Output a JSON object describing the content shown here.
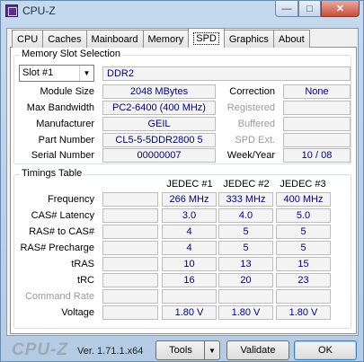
{
  "window": {
    "title": "CPU-Z",
    "minimize_icon": "minimize-icon",
    "maximize_icon": "maximize-icon",
    "close_icon": "close-icon"
  },
  "tabs": [
    {
      "label": "CPU"
    },
    {
      "label": "Caches"
    },
    {
      "label": "Mainboard"
    },
    {
      "label": "Memory"
    },
    {
      "label": "SPD",
      "active": true
    },
    {
      "label": "Graphics"
    },
    {
      "label": "About"
    }
  ],
  "slot": {
    "group_title": "Memory Slot Selection",
    "selected": "Slot #1",
    "type": "DDR2",
    "module_size_label": "Module Size",
    "module_size": "2048 MBytes",
    "max_bandwidth_label": "Max Bandwidth",
    "max_bandwidth": "PC2-6400 (400 MHz)",
    "manufacturer_label": "Manufacturer",
    "manufacturer": "GEIL",
    "part_number_label": "Part Number",
    "part_number": "CL5-5-5DDR2800  5",
    "serial_number_label": "Serial Number",
    "serial_number": "00000007",
    "correction_label": "Correction",
    "correction": "None",
    "registered_label": "Registered",
    "registered": "",
    "buffered_label": "Buffered",
    "buffered": "",
    "spd_ext_label": "SPD Ext.",
    "spd_ext": "",
    "week_year_label": "Week/Year",
    "week_year": "10 / 08"
  },
  "timings": {
    "group_title": "Timings Table",
    "columns": [
      "JEDEC #1",
      "JEDEC #2",
      "JEDEC #3"
    ],
    "rows": [
      {
        "label": "Frequency",
        "values": [
          "266 MHz",
          "333 MHz",
          "400 MHz"
        ],
        "disabled": false
      },
      {
        "label": "CAS# Latency",
        "values": [
          "3.0",
          "4.0",
          "5.0"
        ],
        "disabled": false
      },
      {
        "label": "RAS# to CAS#",
        "values": [
          "4",
          "5",
          "5"
        ],
        "disabled": false
      },
      {
        "label": "RAS# Precharge",
        "values": [
          "4",
          "5",
          "5"
        ],
        "disabled": false
      },
      {
        "label": "tRAS",
        "values": [
          "10",
          "13",
          "15"
        ],
        "disabled": false
      },
      {
        "label": "tRC",
        "values": [
          "16",
          "20",
          "23"
        ],
        "disabled": false
      },
      {
        "label": "Command Rate",
        "values": [
          "",
          "",
          ""
        ],
        "disabled": true
      },
      {
        "label": "Voltage",
        "values": [
          "1.80 V",
          "1.80 V",
          "1.80 V"
        ],
        "disabled": false
      }
    ]
  },
  "footer": {
    "logo": "CPU-Z",
    "version": "Ver. 1.71.1.x64",
    "tools_label": "Tools",
    "validate_label": "Validate",
    "ok_label": "OK"
  },
  "colors": {
    "value_text": "#00007e",
    "disabled_text": "#9a9a9a",
    "close_button": "#c7503c"
  }
}
